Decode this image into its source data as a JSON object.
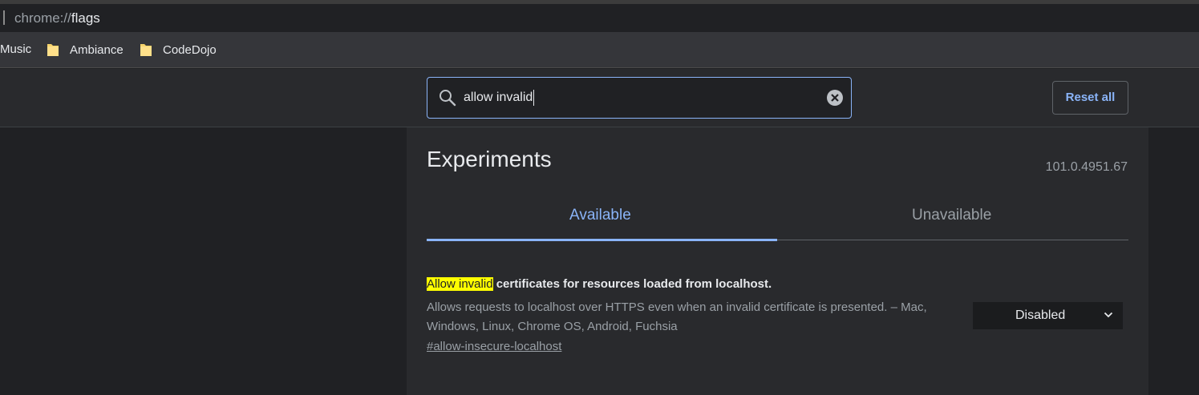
{
  "browser": {
    "url_scheme": "chrome://",
    "url_host": "flags",
    "bookmarks": [
      {
        "label": "Music",
        "icon": "none"
      },
      {
        "label": "Ambiance",
        "icon": "folder-icon"
      },
      {
        "label": "CodeDojo",
        "icon": "folder-icon"
      }
    ]
  },
  "header": {
    "search_value": "allow invalid",
    "reset_label": "Reset all"
  },
  "main": {
    "title": "Experiments",
    "version": "101.0.4951.67",
    "tabs": [
      {
        "label": "Available",
        "active": true
      },
      {
        "label": "Unavailable",
        "active": false
      }
    ],
    "experiment": {
      "title_match": "Allow invalid",
      "title_rest": " certificates for resources loaded from localhost.",
      "description": "Allows requests to localhost over HTTPS even when an invalid certificate is presented. – Mac, Windows, Linux, Chrome OS, Android, Fuchsia",
      "link": "#allow-insecure-localhost",
      "state": "Disabled"
    }
  },
  "colors": {
    "accent": "#8ab4f8",
    "highlight": "#ffff00",
    "background": "#202124",
    "panel": "#292a2d"
  }
}
